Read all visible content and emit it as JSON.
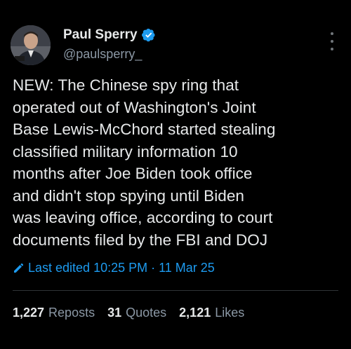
{
  "author": {
    "display_name": "Paul Sperry",
    "handle": "@paulsperry_",
    "verified": true,
    "avatar_icon": "profile-photo"
  },
  "tweet": {
    "text": "NEW: The Chinese spy ring that\noperated out of Washington's Joint\nBase Lewis-McChord started stealing\nclassified military information 10\nmonths after Joe Biden took office\nand didn't stop spying until Biden\nwas leaving office, according to court\ndocuments filed by the FBI and DOJ",
    "edited_label": "Last edited 10:25 PM · 11 Mar 25"
  },
  "stats": {
    "reposts_count": "1,227",
    "reposts_label": "Reposts",
    "quotes_count": "31",
    "quotes_label": "Quotes",
    "likes_count": "2,121",
    "likes_label": "Likes"
  },
  "colors": {
    "background": "#000000",
    "text": "#e7e9ea",
    "muted": "#8b98a5",
    "accent": "#1d9bf0"
  }
}
